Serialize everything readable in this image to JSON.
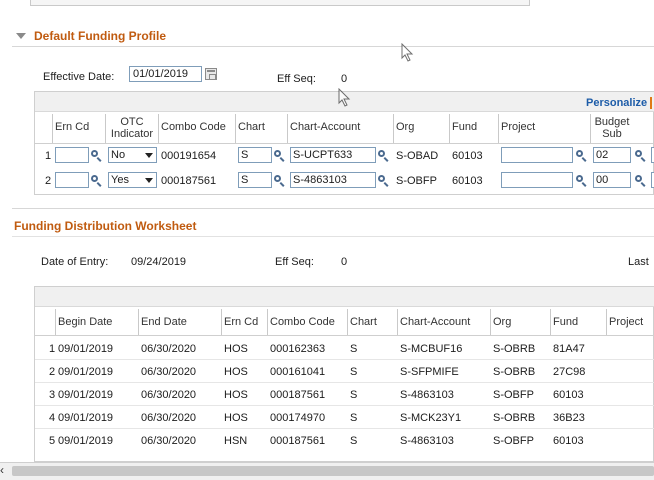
{
  "funding_profile": {
    "section_title": "Default Funding Profile",
    "effective_date_label": "Effective Date:",
    "effective_date_value": "01/01/2019",
    "eff_seq_label": "Eff Seq:",
    "eff_seq_value": "0",
    "personalize_label": "Personalize",
    "columns": {
      "ern_cd": "Ern Cd",
      "otc": "OTC Indicator",
      "combo": "Combo Code",
      "chart": "Chart",
      "chart_account": "Chart-Account",
      "org": "Org",
      "fund": "Fund",
      "project": "Project",
      "budget_sub": "Budget Sub"
    },
    "rows": [
      {
        "num": "1",
        "ern_cd": "",
        "otc": "No",
        "combo": "000191654",
        "chart": "S",
        "chart_account": "S-UCPT633",
        "org": "S-OBAD",
        "fund": "60103",
        "project": "",
        "budget_sub": "02"
      },
      {
        "num": "2",
        "ern_cd": "",
        "otc": "Yes",
        "combo": "000187561",
        "chart": "S",
        "chart_account": "S-4863103",
        "org": "S-OBFP",
        "fund": "60103",
        "project": "",
        "budget_sub": "00"
      }
    ]
  },
  "worksheet": {
    "section_title": "Funding Distribution Worksheet",
    "date_of_entry_label": "Date of Entry:",
    "date_of_entry_value": "09/24/2019",
    "eff_seq_label": "Eff Seq:",
    "eff_seq_value": "0",
    "last_label": "Last",
    "columns": {
      "begin": "Begin Date",
      "end": "End Date",
      "ern_cd": "Ern Cd",
      "combo": "Combo Code",
      "chart": "Chart",
      "chart_account": "Chart-Account",
      "org": "Org",
      "fund": "Fund",
      "project": "Project"
    },
    "rows": [
      {
        "num": "1",
        "begin": "09/01/2019",
        "end": "06/30/2020",
        "ern_cd": "HOS",
        "combo": "000162363",
        "chart": "S",
        "chart_account": "S-MCBUF16",
        "org": "S-OBRB",
        "fund": "81A47"
      },
      {
        "num": "2",
        "begin": "09/01/2019",
        "end": "06/30/2020",
        "ern_cd": "HOS",
        "combo": "000161041",
        "chart": "S",
        "chart_account": "S-SFPMIFE",
        "org": "S-OBRB",
        "fund": "27C98"
      },
      {
        "num": "3",
        "begin": "09/01/2019",
        "end": "06/30/2020",
        "ern_cd": "HOS",
        "combo": "000187561",
        "chart": "S",
        "chart_account": "S-4863103",
        "org": "S-OBFP",
        "fund": "60103"
      },
      {
        "num": "4",
        "begin": "09/01/2019",
        "end": "06/30/2020",
        "ern_cd": "HOS",
        "combo": "000174970",
        "chart": "S",
        "chart_account": "S-MCK23Y1",
        "org": "S-OBRB",
        "fund": "36B23"
      },
      {
        "num": "5",
        "begin": "09/01/2019",
        "end": "06/30/2020",
        "ern_cd": "HSN",
        "combo": "000187561",
        "chart": "S",
        "chart_account": "S-4863103",
        "org": "S-OBFP",
        "fund": "60103"
      }
    ]
  },
  "icons": {
    "lookup": "magnifier-icon",
    "calendar": "calendar-icon",
    "collapse": "triangle-down-icon",
    "scroll_left": "arrow-left-icon"
  },
  "colors": {
    "section_title": "#c05b10",
    "link": "#1d5ca8",
    "input_border": "#7f9db9"
  }
}
